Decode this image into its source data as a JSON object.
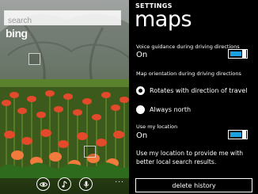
{
  "bing": {
    "search_placeholder": "search",
    "logo_text": "bing",
    "app_bar": {
      "buttons": [
        {
          "icon": "eye-icon"
        },
        {
          "icon": "music-note-icon"
        },
        {
          "icon": "microphone-icon"
        }
      ],
      "more": "..."
    }
  },
  "settings": {
    "header": "SETTINGS",
    "title": "maps",
    "voice_guidance": {
      "label": "Voice guidance during driving directions",
      "state": "On",
      "enabled": true
    },
    "map_orientation": {
      "label": "Map orientation during driving directions",
      "options": [
        {
          "label": "Rotates with direction of travel",
          "selected": true
        },
        {
          "label": "Always north",
          "selected": false
        }
      ]
    },
    "use_location": {
      "label": "Use my location",
      "state": "On",
      "enabled": true
    },
    "info": "Use my location to provide me with better local search results.",
    "delete_history_label": "delete history",
    "accent_color": "#1ba1e2"
  }
}
